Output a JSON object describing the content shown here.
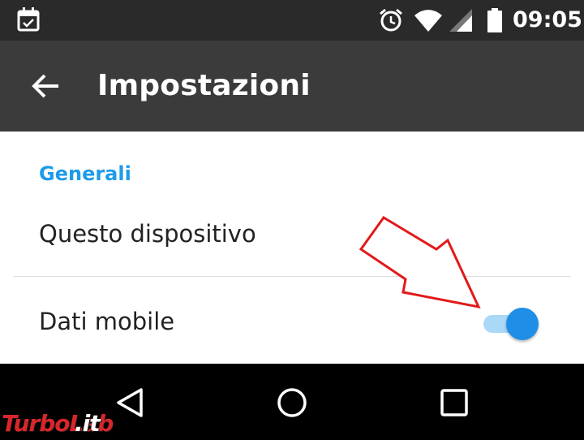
{
  "status_bar": {
    "time": "09:05",
    "icons": [
      "calendar-check-icon",
      "alarm-clock-icon",
      "wifi-icon",
      "cell-signal-icon",
      "battery-icon"
    ]
  },
  "app_bar": {
    "title": "Impostazioni",
    "back_icon": "arrow-left-icon"
  },
  "settings": {
    "section_header": "Generali",
    "items": [
      {
        "label": "Questo dispositivo"
      },
      {
        "label": "Dati mobile",
        "toggle_on": true
      }
    ]
  },
  "navigation_bar": {
    "icons": [
      "triangle-back-icon",
      "circle-home-icon",
      "square-recents-icon"
    ]
  },
  "watermark": {
    "part1": "TurboLab",
    "part2": ".it"
  },
  "colors": {
    "status_bar_bg": "#2a2a2a",
    "app_bar_bg": "#3b3b3b",
    "accent": "#1e9be8",
    "switch_track": "#aad8f7",
    "switch_thumb": "#1e8ee6",
    "annotation_arrow": "#e21a1a",
    "nav_bar_bg": "#000000"
  }
}
